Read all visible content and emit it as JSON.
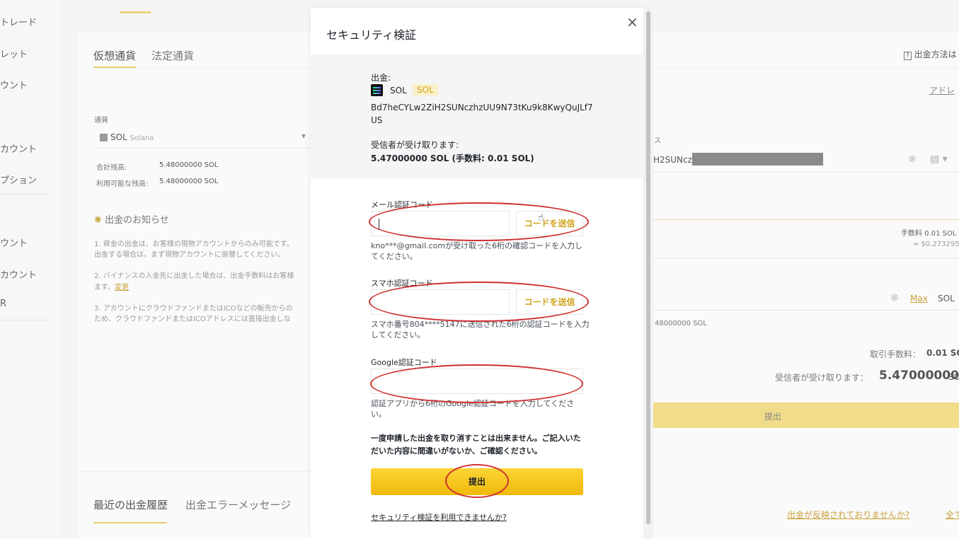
{
  "sidebar": {
    "items": [
      "トレード",
      "レット",
      "ウント",
      "カウント",
      "プション",
      "ウント",
      "カウント",
      "R"
    ]
  },
  "background": {
    "tabs": {
      "crypto": "仮想通貨",
      "fiat": "法定通貨"
    },
    "currency_label": "通貨",
    "coin_select": {
      "symbol": "SOL",
      "name": "Solana"
    },
    "total_balance_label": "合計残高:",
    "total_balance_value": "5.48000000 SOL",
    "available_label": "利用可能な残高:",
    "available_value": "5.48000000 SOL",
    "notice_title": "出金のお知らせ",
    "notice_lines": [
      "1. 資金の出金は、お客様の現物アカウントからのみ可能です。",
      "出金する場合は、まず現物アカウントに振替してください。",
      "2. バイナンスの入金先に出金した場合は、出金手数料はお客様",
      "ます。",
      "3. アカウントにクラウドファンドまたはICOなどの販売からの",
      "ため、クラウドファンドまたはICOアドレスには直接出金しな"
    ],
    "notice_change_link": "変更",
    "history_tabs": {
      "recent": "最近の出金履歴",
      "errors": "出金エラーメッセージ"
    },
    "help_link": "出金方法は",
    "address_book_link": "アドレ",
    "address_label_fragment": "ス",
    "address_value_fragment": "H2SUNczl",
    "fee_text": "手数料 0.01 SOL",
    "fee_usd": "≈ $0.273295",
    "max_link": "Max",
    "amount_unit": "SOL",
    "balance_fragment": "48000000 SOL",
    "tx_fee_label": "取引手数料：",
    "tx_fee_value": "0.01 SO",
    "receive_label": "受信者が受け取ります：",
    "receive_value": "5.47000000",
    "receive_unit": "SO",
    "submit_label": "提出",
    "not_reflected_link": "出金が反映されておりませんか?",
    "all_link": "全て"
  },
  "modal": {
    "title": "セキュリティ検証",
    "close": "×",
    "withdraw_label": "出金:",
    "coin": "SOL",
    "coin_badge": "SOL",
    "address_line1": "Bd7heCYLw2ZiH2SUNczhzUU9N73tKu9k8KwyQuJLf7",
    "address_line2": "US",
    "receive_label": "受信者が受け取ります:",
    "receive_value": "5.47000000 SOL (手数料: 0.01 SOL)",
    "email_label": "メール認証コード",
    "email_send": "コードを送信",
    "email_hint_1": "kno***@gmail.comが受け取った6桁の確認コードを入力し",
    "email_hint_2": "てください。",
    "phone_label": "スマホ認証コード",
    "phone_send": "コードを送信",
    "phone_hint_1": "スマホ番号804****5147に送信された6桁の認証コードを入力",
    "phone_hint_2": "してください。",
    "google_label": "Google認証コード",
    "google_hint_1": "認証アプリから6桁のGoogle認証コードを入力してくださ",
    "google_hint_2": "い。",
    "warning_1": "一度申請した出金を取り消すことは出来ません。ご記入いた",
    "warning_2": "だいた内容に間違いがないか、ご確認ください。",
    "submit": "提出",
    "help_link": "セキュリティ検証を利用できませんか?"
  },
  "colors": {
    "accent": "#f0b90b",
    "annotation": "#d03030"
  }
}
